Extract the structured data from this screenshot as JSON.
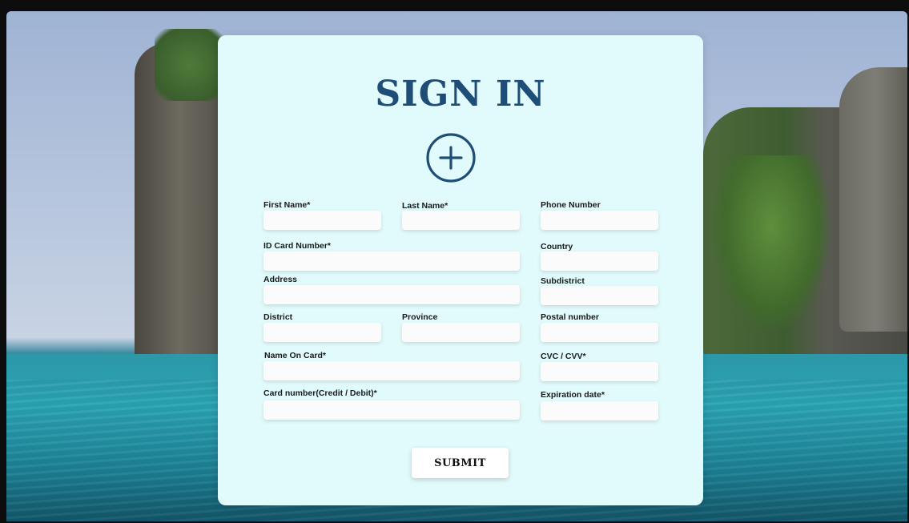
{
  "form": {
    "title": "SIGN IN",
    "fields": {
      "first_name": {
        "label": "First Name*",
        "value": ""
      },
      "last_name": {
        "label": "Last Name*",
        "value": ""
      },
      "phone_number": {
        "label": "Phone Number",
        "value": ""
      },
      "id_card_number": {
        "label": "ID Card Number*",
        "value": ""
      },
      "country": {
        "label": "Country",
        "value": ""
      },
      "address": {
        "label": "Address",
        "value": ""
      },
      "subdistrict": {
        "label": "Subdistrict",
        "value": ""
      },
      "district": {
        "label": "District",
        "value": ""
      },
      "province": {
        "label": "Province",
        "value": ""
      },
      "postal_number": {
        "label": "Postal number",
        "value": ""
      },
      "name_on_card": {
        "label": "Name On Card*",
        "value": ""
      },
      "cvc_cvv": {
        "label": "CVC / CVV*",
        "value": ""
      },
      "card_number": {
        "label": "Card number(Credit / Debit)*",
        "value": ""
      },
      "expiration_date": {
        "label": "Expiration date*",
        "value": ""
      }
    },
    "submit_label": "SUBMIT",
    "add_icon": "plus-circle-icon"
  },
  "colors": {
    "card_background": "#e1fafb",
    "title": "#1e4e77",
    "icon": "#1e4e77"
  }
}
